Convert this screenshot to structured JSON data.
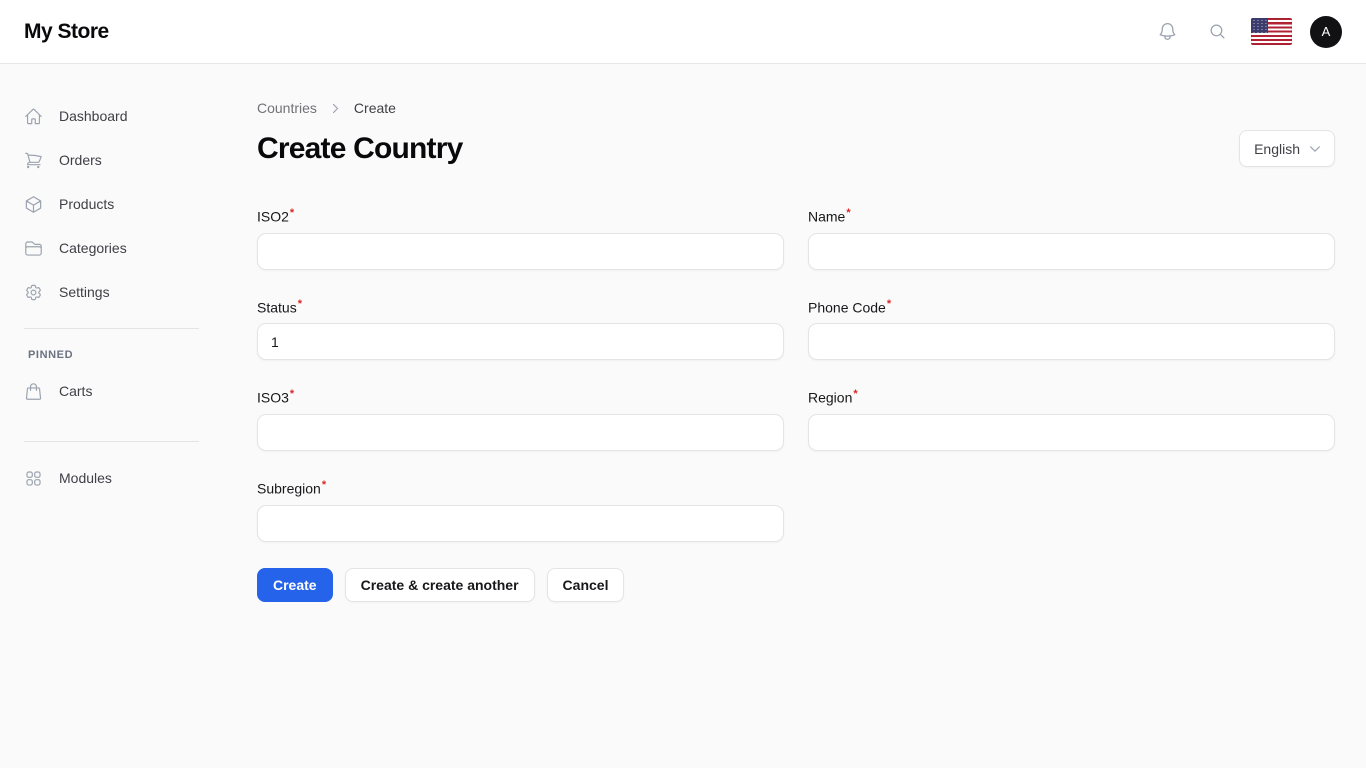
{
  "topbar": {
    "brand": "My Store",
    "avatar_initial": "A",
    "icons": [
      "bell-icon",
      "search-icon",
      "us-flag",
      "avatar"
    ]
  },
  "sidebar": {
    "items": [
      {
        "label": "Dashboard",
        "icon": "home-icon"
      },
      {
        "label": "Orders",
        "icon": "shopping-cart-icon"
      },
      {
        "label": "Products",
        "icon": "cube-icon"
      },
      {
        "label": "Categories",
        "icon": "folder-icon"
      },
      {
        "label": "Settings",
        "icon": "gear-icon"
      }
    ],
    "pinned": {
      "group_label": "PINNED",
      "items": [
        {
          "label": "Carts",
          "icon": "shopping-bag-icon"
        }
      ]
    },
    "footer_items": [
      {
        "label": "Modules",
        "icon": "grid-icon"
      }
    ]
  },
  "page": {
    "breadcrumb": {
      "parent": "Countries",
      "current": "Create"
    },
    "title": "Create Country",
    "language_selector": {
      "selected": "English"
    }
  },
  "form": {
    "required_marker": "*",
    "fields": [
      {
        "label": "ISO2",
        "required": true,
        "value": ""
      },
      {
        "label": "Name",
        "required": true,
        "value": ""
      },
      {
        "label": "Status",
        "required": true,
        "value": "1"
      },
      {
        "label": "Phone Code",
        "required": true,
        "value": ""
      },
      {
        "label": "ISO3",
        "required": true,
        "value": ""
      },
      {
        "label": "Region",
        "required": true,
        "value": ""
      },
      {
        "label": "Subregion",
        "required": true,
        "value": ""
      }
    ],
    "buttons": {
      "create": "Create",
      "create_another": "Create & create another",
      "cancel": "Cancel"
    }
  },
  "colors": {
    "primary_button": "#2563eb",
    "required_asterisk": "#dc2626",
    "page_background": "#fafafa",
    "topbar_background": "#ffffff",
    "avatar_background": "#111113"
  }
}
